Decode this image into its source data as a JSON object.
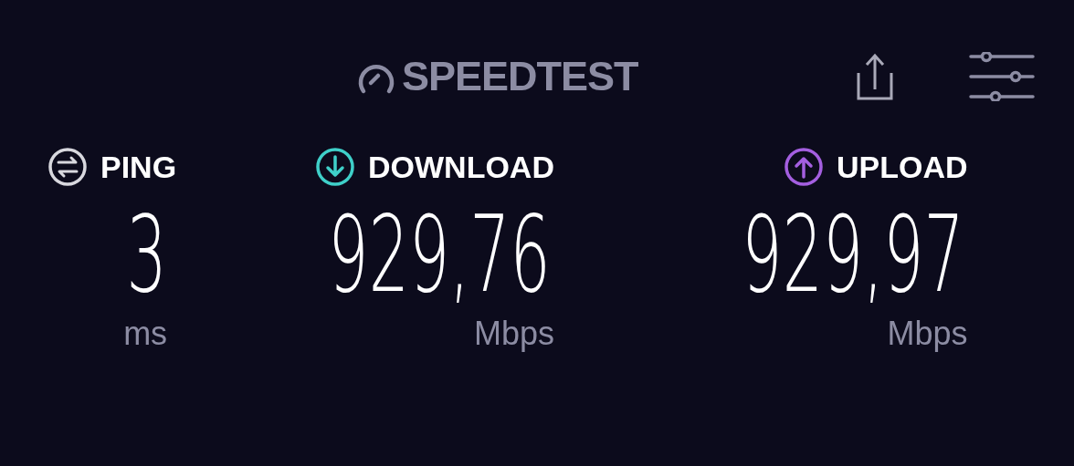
{
  "header": {
    "logo_text": "SPEEDTEST"
  },
  "metrics": [
    {
      "kind": "ping",
      "label": "PING",
      "value": "3",
      "unit": "ms",
      "color": "#d8d8de"
    },
    {
      "kind": "download",
      "label": "DOWNLOAD",
      "value": "929,76",
      "unit": "Mbps",
      "color": "#3fd0c9"
    },
    {
      "kind": "upload",
      "label": "UPLOAD",
      "value": "929,97",
      "unit": "Mbps",
      "color": "#a45fe0"
    }
  ]
}
